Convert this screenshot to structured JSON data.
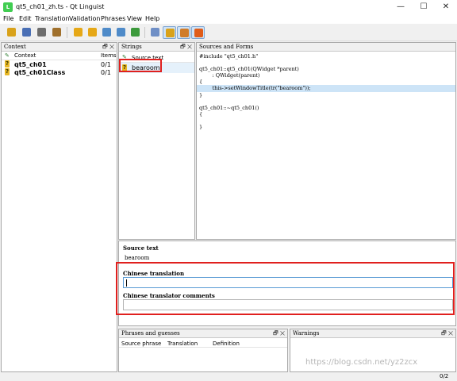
{
  "window": {
    "title": "qt5_ch01_zh.ts - Qt Linguist",
    "controls": {
      "minimize": "—",
      "maximize": "☐",
      "close": "✕"
    }
  },
  "menu": [
    "File",
    "Edit",
    "Translation",
    "Validation",
    "Phrases",
    "View",
    "Help"
  ],
  "toolbar_icons": [
    {
      "name": "open-icon",
      "color": "#d9a21b"
    },
    {
      "name": "save-icon",
      "color": "#4a6fb5"
    },
    {
      "name": "print-icon",
      "color": "#6d6d6d"
    },
    {
      "name": "phrasebook-icon",
      "color": "#a0702c"
    },
    {
      "name": "prev-unfinished-icon",
      "color": "#e6a817"
    },
    {
      "name": "next-unfinished-icon",
      "color": "#e6a817"
    },
    {
      "name": "prev-icon",
      "color": "#4f8bc9"
    },
    {
      "name": "next-icon",
      "color": "#4f8bc9"
    },
    {
      "name": "done-next-icon",
      "color": "#3c9a3c"
    },
    {
      "name": "accelerators-icon",
      "color": "#6f8fc6"
    },
    {
      "name": "ending-punctuation-icon",
      "color": "#d9a21b"
    },
    {
      "name": "phrase-matches-icon",
      "color": "#d07c2a"
    },
    {
      "name": "place-markers-icon",
      "color": "#e05d1a"
    }
  ],
  "context_pane": {
    "title": "Context",
    "columns": [
      "Context",
      "Items"
    ],
    "rows": [
      {
        "name": "qt5_ch01",
        "items": "0/1"
      },
      {
        "name": "qt5_ch01Class",
        "items": "0/1"
      }
    ]
  },
  "strings_pane": {
    "title": "Strings",
    "column": "Source text",
    "rows": [
      {
        "text": "bearoom"
      }
    ]
  },
  "sources_pane": {
    "title": "Sources and Forms",
    "lines": [
      "#include \"qt5_ch01.h\"",
      "",
      "qt5_ch01::qt5_ch01(QWidget *parent)",
      "        : QWidget(parent)",
      "{",
      "        this->setWindowTitle(tr(\"bearoom\"));",
      "}",
      "",
      "qt5_ch01::~qt5_ch01()",
      "{",
      "",
      "}"
    ],
    "highlight_line": 5
  },
  "editor": {
    "source_label": "Source text",
    "source_value": "bearoom",
    "translation_label": "Chinese translation",
    "translation_value": "",
    "comments_label": "Chinese translator comments",
    "comments_value": ""
  },
  "phrases_pane": {
    "title": "Phrases and guesses",
    "columns": [
      "Source phrase",
      "Translation",
      "Definition"
    ]
  },
  "warnings_pane": {
    "title": "Warnings"
  },
  "dock_buttons": "🗗 ✕",
  "status": "0/2",
  "watermark": "https://blog.csdn.net/yz2zcx"
}
